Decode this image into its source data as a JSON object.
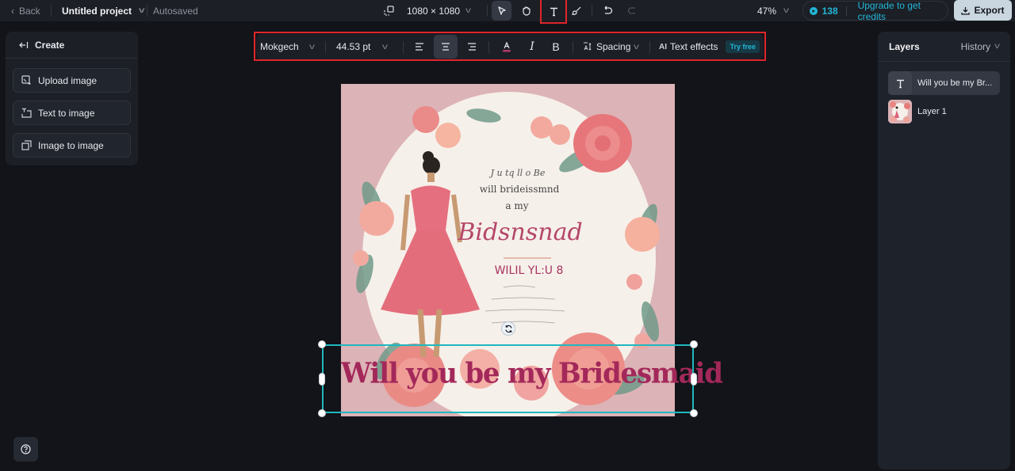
{
  "topbar": {
    "back_label": "Back",
    "project_title": "Untitled project",
    "save_status": "Autosaved",
    "canvas_size": "1080 × 1080",
    "zoom_level": "47%",
    "credits": "138",
    "upgrade_label": "Upgrade to get credits",
    "export_label": "Export",
    "tools": [
      "select",
      "hand",
      "text",
      "brush",
      "undo",
      "redo"
    ],
    "active_tool": "select",
    "highlighted_tool": "text"
  },
  "left_panel": {
    "header": "Create",
    "buttons": [
      {
        "label": "Upload image",
        "icon": "upload-image-icon"
      },
      {
        "label": "Text to image",
        "icon": "text-to-image-icon"
      },
      {
        "label": "Image to image",
        "icon": "image-to-image-icon"
      }
    ]
  },
  "format_toolbar": {
    "font": "Mokgech",
    "font_size": "44.53 pt",
    "alignment": "center",
    "text_color": "#b33a6b",
    "italic_label": "I",
    "bold_label": "B",
    "spacing_label": "Spacing",
    "effects_label": "Text effects",
    "effects_badge": "Try free"
  },
  "right_panel": {
    "title": "Layers",
    "history_label": "History",
    "layers": [
      {
        "name": "Will you be my Br...",
        "type": "text",
        "selected": true
      },
      {
        "name": "Layer 1",
        "type": "image",
        "selected": false
      }
    ]
  },
  "canvas": {
    "selected_text": "Will you be my Bridesmaid",
    "image_text": {
      "line1": "J u tq ll o Be",
      "line2": "will brideissmnd",
      "line3": "a my",
      "script": "Bidsnsnad",
      "caps": "WILIL YL:U 8"
    }
  },
  "colors": {
    "accent": "#22b6d6",
    "highlight_box": "#e0252b",
    "selection": "#1fb8bf",
    "text_fill": "#a3285a"
  }
}
